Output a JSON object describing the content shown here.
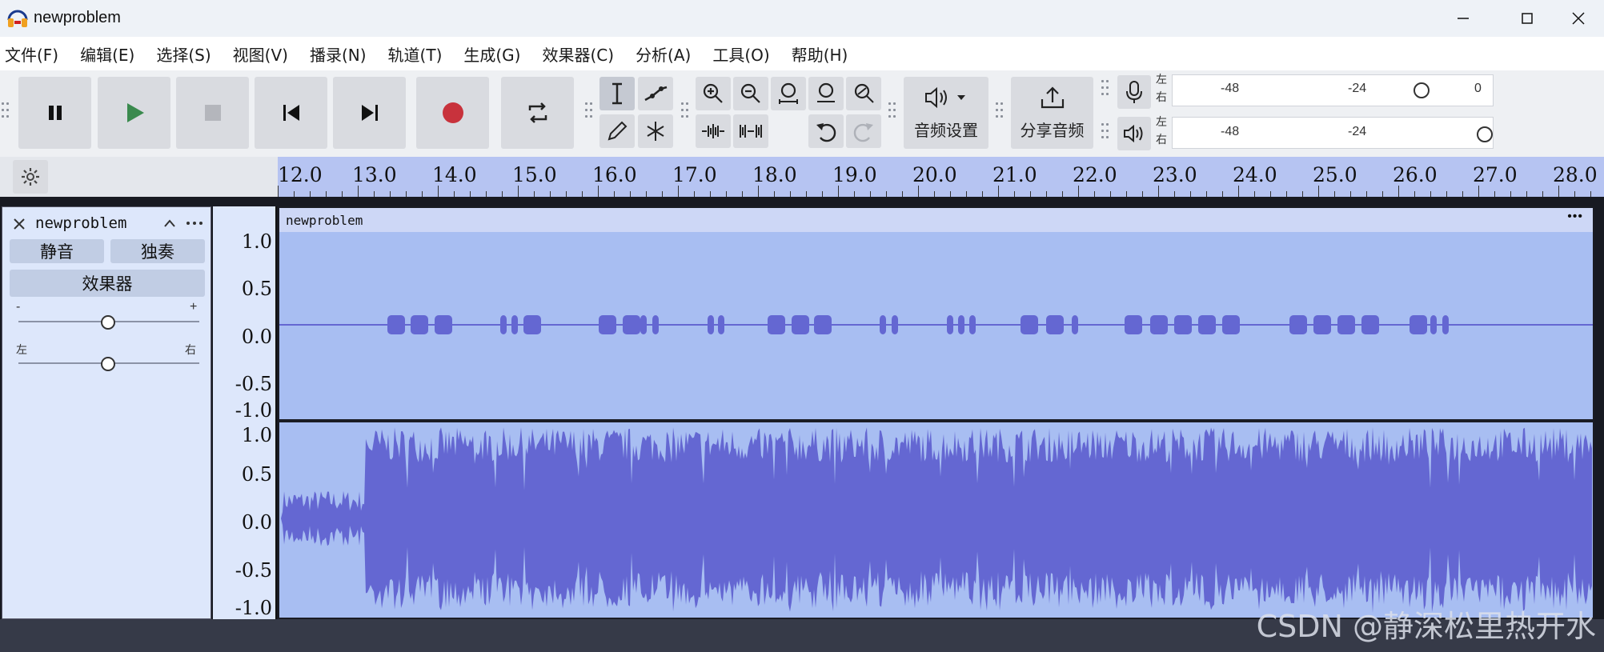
{
  "window": {
    "title": "newproblem"
  },
  "menu": [
    "文件(F)",
    "编辑(E)",
    "选择(S)",
    "视图(V)",
    "播录(N)",
    "轨道(T)",
    "生成(G)",
    "效果器(C)",
    "分析(A)",
    "工具(O)",
    "帮助(H)"
  ],
  "toolbar": {
    "audio_setup_label": "音频设置",
    "share_audio_label": "分享音频",
    "record_meter": {
      "left": "左",
      "right": "右",
      "marks": [
        "-48",
        "-24",
        "0"
      ]
    },
    "play_meter": {
      "left": "左",
      "right": "右",
      "marks": [
        "-48",
        "-24"
      ]
    }
  },
  "ruler": {
    "labels": [
      "12.0",
      "13.0",
      "14.0",
      "15.0",
      "16.0",
      "17.0",
      "18.0",
      "19.0",
      "20.0",
      "21.0",
      "22.0",
      "23.0",
      "24.0",
      "25.0",
      "26.0",
      "27.0",
      "28.0"
    ]
  },
  "track": {
    "name": "newproblem",
    "mute_label": "静音",
    "solo_label": "独奏",
    "effects_label": "效果器",
    "gain_minus": "-",
    "gain_plus": "+",
    "pan_left": "左",
    "pan_right": "右",
    "clip_name": "newproblem",
    "clip_menu": "•••",
    "scale_top": [
      "1.0",
      "0.5",
      "0.0",
      "-0.5",
      "-1.0"
    ],
    "scale_bottom": [
      "1.0",
      "0.5",
      "0.0",
      "-0.5",
      "-1.0"
    ]
  },
  "watermark": "CSDN @静深松里热开水",
  "colors": {
    "waveform": "#6467d2",
    "clip_bg": "#a8bef2",
    "ruler_bg": "#b6c4f2",
    "record": "#c8323c",
    "play": "#3a8a4e"
  }
}
